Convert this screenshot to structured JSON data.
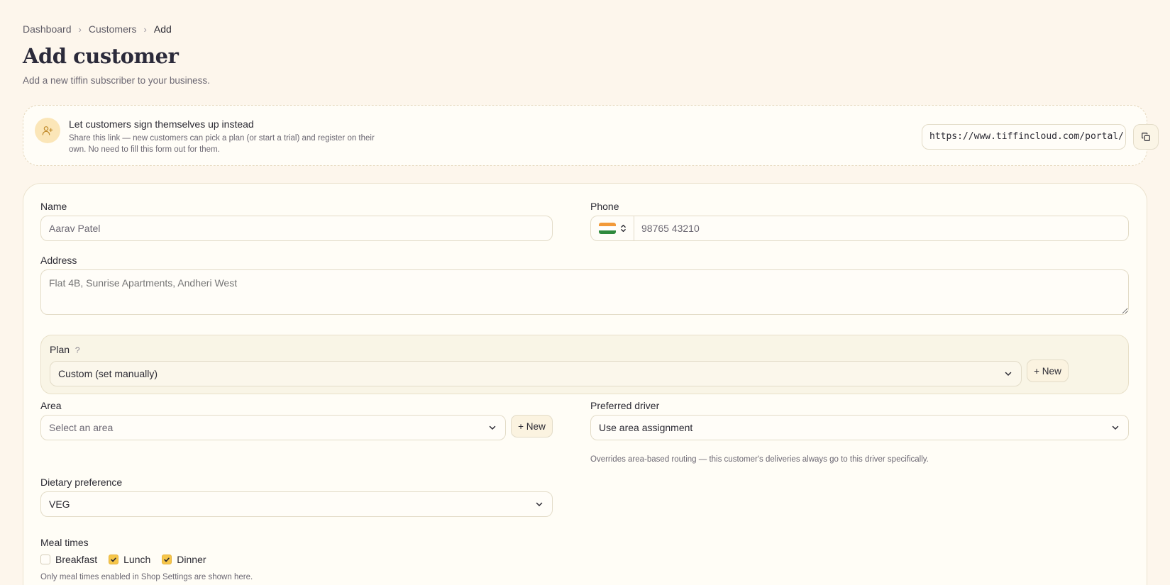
{
  "breadcrumb": {
    "items": [
      "Dashboard",
      "Customers",
      "Add"
    ]
  },
  "header": {
    "title": "Add customer",
    "subtitle": "Add a new tiffin subscriber to your business."
  },
  "signup": {
    "title": "Let customers sign themselves up instead",
    "description": "Share this link — new customers can pick a plan (or start a trial) and register on their own. No need to fill this form out for them.",
    "link": "https://www.tiffincloud.com/portal/",
    "icon": "user-plus-icon",
    "copy_icon": "copy-icon"
  },
  "form": {
    "name": {
      "label": "Name",
      "placeholder": "Aarav Patel"
    },
    "phone": {
      "label": "Phone",
      "placeholder": "98765 43210",
      "country": "IN"
    },
    "address": {
      "label": "Address",
      "placeholder": "Flat 4B, Sunrise Apartments, Andheri West"
    },
    "plan": {
      "label": "Plan",
      "help": "?",
      "value": "Custom (set manually)",
      "new_label": "+ New"
    },
    "area": {
      "label": "Area",
      "value": "Select an area",
      "new_label": "+ New"
    },
    "driver": {
      "label": "Preferred driver",
      "value": "Use area assignment",
      "help": "Overrides area-based routing — this customer's deliveries always go to this driver specifically."
    },
    "dietary": {
      "label": "Dietary preference",
      "value": "VEG"
    },
    "meal_times": {
      "label": "Meal times",
      "options": [
        {
          "label": "Breakfast",
          "checked": false
        },
        {
          "label": "Lunch",
          "checked": true
        },
        {
          "label": "Dinner",
          "checked": true
        }
      ],
      "note": "Only meal times enabled in Shop Settings are shown here."
    }
  },
  "colors": {
    "background": "#fdf6ec",
    "accent": "#f6c64a",
    "card": "#fffdf6"
  }
}
